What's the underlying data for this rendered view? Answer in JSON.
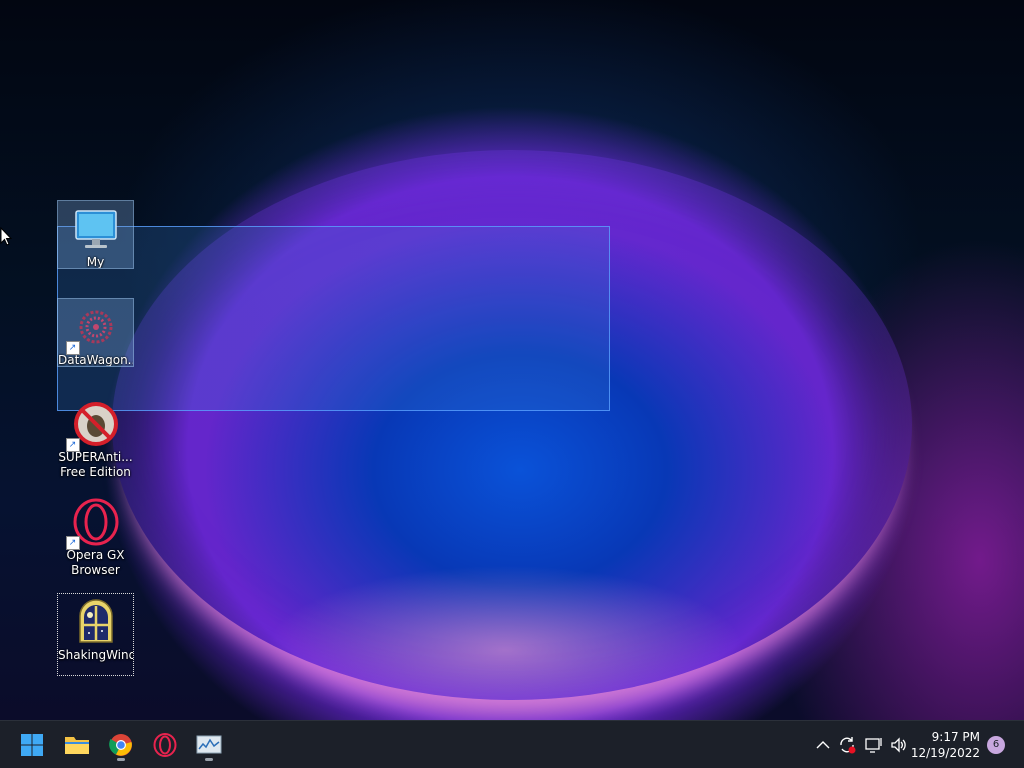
{
  "desktop": {
    "icons": [
      {
        "label": "My Computer",
        "icon": "monitor-icon",
        "selected": true
      },
      {
        "label": "DataWagon...",
        "icon": "datawagon-icon",
        "selected": true,
        "shortcut": true
      },
      {
        "label": "SUPERAnti... Free Edition",
        "icon": "superantispyware-icon",
        "shortcut": true
      },
      {
        "label": "Opera GX Browser",
        "icon": "opera-gx-icon",
        "shortcut": true
      },
      {
        "label": "ShakingWindow.exe",
        "icon": "night-window-icon",
        "focused": true
      }
    ]
  },
  "taskbar": {
    "buttons": [
      "start-icon",
      "file-explorer-icon",
      "chrome-icon",
      "opera-gx-icon",
      "resource-monitor-icon"
    ],
    "clock": {
      "time": "9:17 PM",
      "date": "12/19/2022"
    },
    "notification_count": "6"
  },
  "colors": {
    "taskbar": "#1c2029",
    "selection": "#3c82dc",
    "accent": "#0a52d8"
  }
}
